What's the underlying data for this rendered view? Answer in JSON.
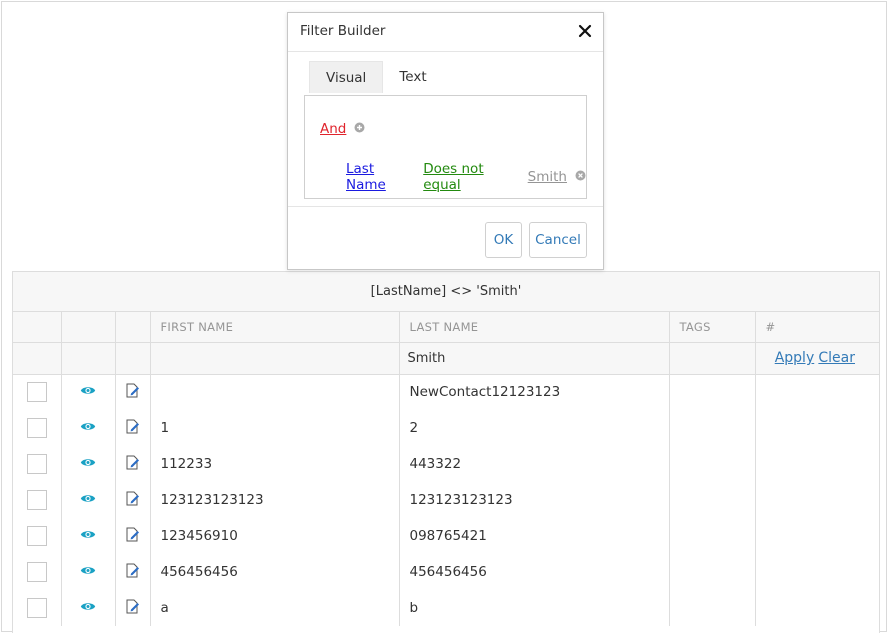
{
  "dialog": {
    "title": "Filter Builder",
    "tabs": [
      {
        "label": "Visual",
        "active": true
      },
      {
        "label": "Text",
        "active": false
      }
    ],
    "group_operator": "And",
    "condition": {
      "field": "Last Name",
      "operator": "Does not equal",
      "value": "Smith"
    },
    "ok_label": "OK",
    "cancel_label": "Cancel"
  },
  "grid": {
    "filter_expression": "[LastName] <> 'Smith'",
    "columns": [
      "",
      "",
      "",
      "FIRST NAME",
      "LAST NAME",
      "TAGS",
      "#"
    ],
    "filter_row": {
      "last_name_value": "Smith",
      "apply_label": "Apply",
      "clear_label": "Clear"
    },
    "rows": [
      {
        "first": "",
        "last": "NewContact12123123",
        "tags": ""
      },
      {
        "first": "1",
        "last": "2",
        "tags": ""
      },
      {
        "first": "112233",
        "last": "443322",
        "tags": ""
      },
      {
        "first": "123123123123",
        "last": "123123123123",
        "tags": ""
      },
      {
        "first": "123456910",
        "last": "098765421",
        "tags": ""
      },
      {
        "first": "456456456",
        "last": "456456456",
        "tags": ""
      },
      {
        "first": "a",
        "last": "b",
        "tags": ""
      }
    ]
  },
  "colors": {
    "accent": "#337ab7",
    "eye_icon": "#1aa1c4",
    "group_operator": "#e0232c",
    "field": "#1a1ae0",
    "operator": "#238a0f",
    "value": "#959595"
  }
}
